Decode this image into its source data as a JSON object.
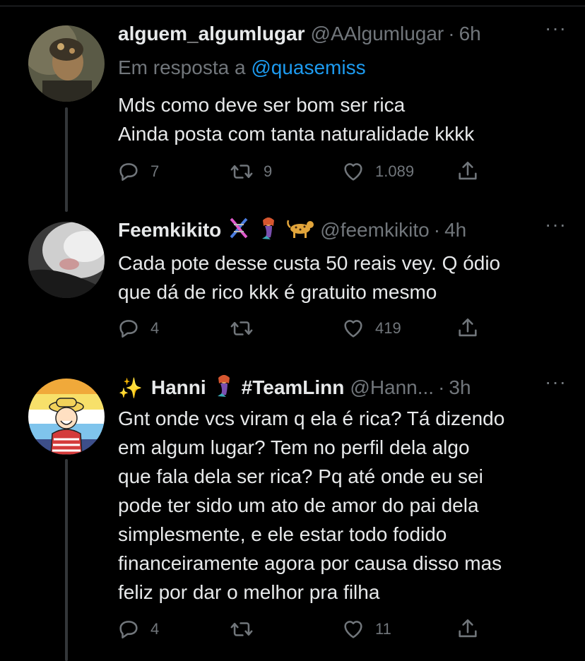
{
  "tweets": [
    {
      "name": "alguem_algumlugar",
      "handle": "@AAlgumlugar",
      "time": "6h",
      "more": "···",
      "reply_prefix": "Em resposta a ",
      "reply_mention": "@quasemiss",
      "lines": [
        "Mds como deve ser bom ser rica",
        "Ainda posta com tanta naturalidade kkkk"
      ],
      "replies": "7",
      "retweets": "9",
      "likes": "1.089"
    },
    {
      "name": "Feemkikito",
      "handle": "@feemkikito",
      "time": "4h",
      "more": "···",
      "lines": [
        "Cada pote desse custa 50 reais vey. Q ódio",
        "que dá de rico kkk é gratuito mesmo"
      ],
      "replies": "4",
      "retweets": "",
      "likes": "419"
    },
    {
      "name_pre": "✨",
      "name": "Hanni",
      "name_post": "#TeamLinn",
      "handle": "@Hann...",
      "time": "3h",
      "more": "···",
      "lines": [
        "Gnt onde vcs viram q ela é rica? Tá dizendo",
        "em algum lugar? Tem no perfil dela algo",
        "que fala dela ser rica? Pq até onde eu sei",
        "pode ter sido um ato de amor do pai dela",
        "simplesmente, e ele estar todo fodido",
        "financeiramente agora por causa disso mas",
        "feliz por dar o melhor pra filha"
      ],
      "replies": "4",
      "retweets": "",
      "likes": "11"
    }
  ],
  "colors": {
    "background": "#000000",
    "text": "#e7e9ea",
    "muted": "#71767b",
    "link": "#1d9bf0"
  },
  "icons": [
    "reply-icon",
    "retweet-icon",
    "like-icon",
    "share-icon",
    "more-icon",
    "sparkles-icon",
    "dna-icon",
    "mermaid-icon",
    "leopard-icon"
  ]
}
